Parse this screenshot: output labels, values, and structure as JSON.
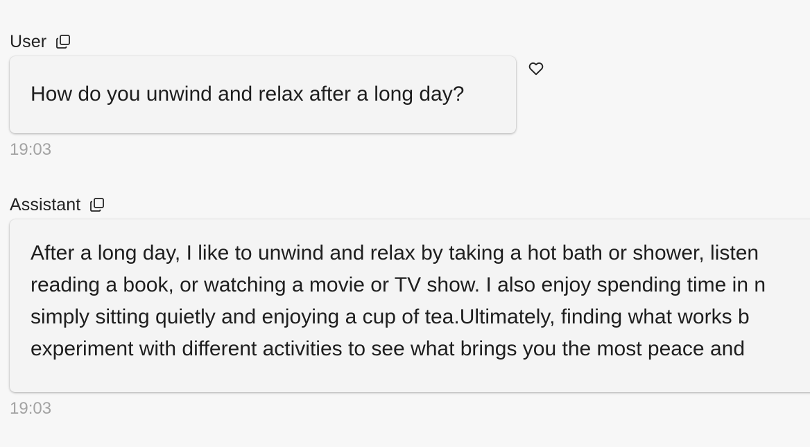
{
  "messages": {
    "user": {
      "role": "User",
      "text": "How do you unwind and relax after a long day?",
      "time": "19:03"
    },
    "assistant": {
      "role": "Assistant",
      "lines": [
        "After a long day, I like to unwind and relax by taking a hot bath or shower, listen",
        "reading a book, or watching a movie or TV show. I also enjoy spending time in n",
        "simply sitting quietly and enjoying a cup of tea.Ultimately, finding what works b",
        "experiment with different activities to see what brings you the most peace and"
      ],
      "time": "19:03"
    }
  },
  "icons": {
    "copy": "copy-icon",
    "like": "heart-icon"
  },
  "colors": {
    "background": "#f7f7f7",
    "bubble": "#f4f4f4",
    "timestamp": "#a3a3a3",
    "text": "#1e1e1e"
  }
}
